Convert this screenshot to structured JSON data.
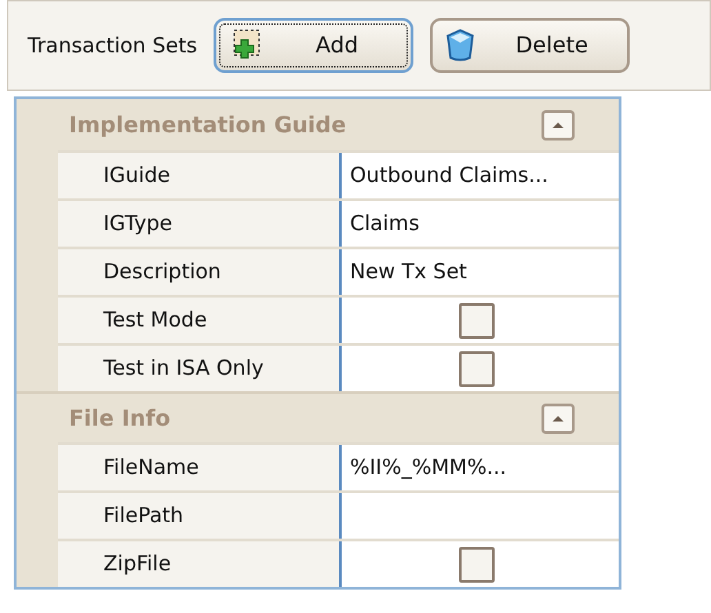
{
  "toolbar": {
    "label": "Transaction Sets",
    "buttons": [
      {
        "label": "Add",
        "kind": "add",
        "focused": true
      },
      {
        "label": "Delete",
        "kind": "delete",
        "focused": false
      }
    ]
  },
  "sections": [
    {
      "title": "Implementation Guide",
      "expanded": true,
      "rows": [
        {
          "label": "IGuide",
          "kind": "text",
          "value": "Outbound Claims..."
        },
        {
          "label": "IGType",
          "kind": "text",
          "value": "Claims"
        },
        {
          "label": "Description",
          "kind": "text",
          "value": "New Tx Set"
        },
        {
          "label": "Test Mode",
          "kind": "checkbox",
          "checked": false
        },
        {
          "label": "Test in ISA Only",
          "kind": "checkbox",
          "checked": false
        }
      ]
    },
    {
      "title": "File Info",
      "expanded": true,
      "rows": [
        {
          "label": "FileName",
          "kind": "text",
          "value": "%II%_%MM%..."
        },
        {
          "label": "FilePath",
          "kind": "text"
        },
        {
          "label": "ZipFile",
          "kind": "checkbox",
          "checked": false
        }
      ]
    }
  ]
}
